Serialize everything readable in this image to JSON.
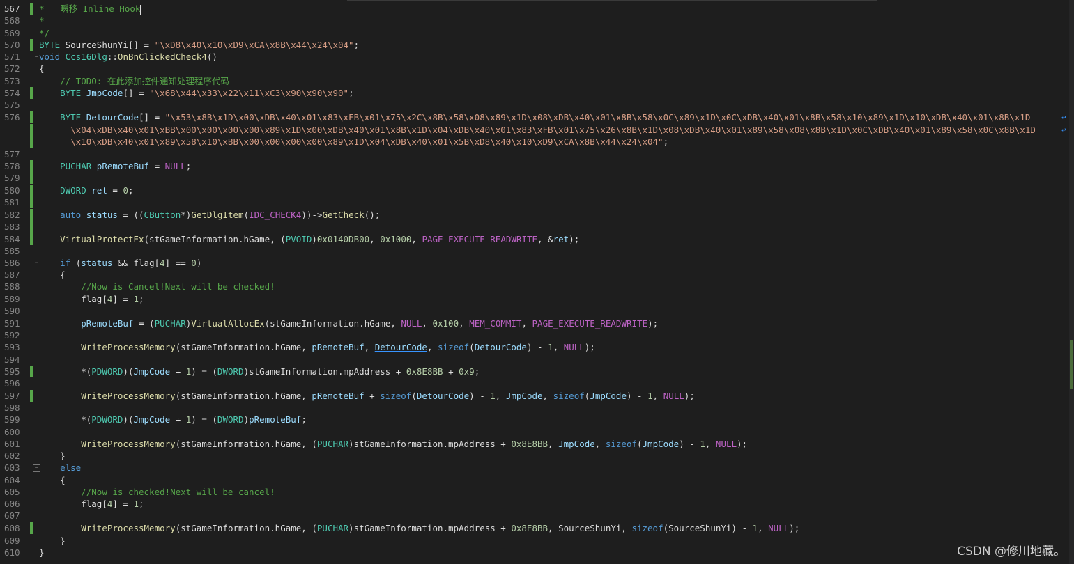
{
  "lines": [
    {
      "n": "567",
      "mark": true,
      "cursor": true,
      "tokens": [
        [
          "cmt",
          "*   瞬移 Inline Hook"
        ]
      ]
    },
    {
      "n": "568",
      "mark": false,
      "tokens": [
        [
          "cmt",
          "*"
        ]
      ]
    },
    {
      "n": "569",
      "mark": false,
      "tokens": [
        [
          "cmt",
          "*/"
        ]
      ]
    },
    {
      "n": "570",
      "mark": true,
      "tokens": [
        [
          "type",
          "BYTE"
        ],
        [
          "plain",
          " SourceShunYi[] = "
        ],
        [
          "str",
          "\"\\xD8\\x40\\x10\\xD9\\xCA\\x8B\\x44\\x24\\x04\""
        ],
        [
          "plain",
          ";"
        ]
      ]
    },
    {
      "n": "571",
      "mark": false,
      "fold": true,
      "tokens": [
        [
          "kw",
          "void"
        ],
        [
          "plain",
          " "
        ],
        [
          "type",
          "Ccs16Dlg"
        ],
        [
          "plain",
          "::"
        ],
        [
          "fn",
          "OnBnClickedCheck4"
        ],
        [
          "plain",
          "()"
        ]
      ]
    },
    {
      "n": "572",
      "mark": false,
      "tokens": [
        [
          "plain",
          "{"
        ]
      ]
    },
    {
      "n": "573",
      "mark": false,
      "tokens": [
        [
          "plain",
          "    "
        ],
        [
          "cmt",
          "// TODO: 在此添加控件通知处理程序代码"
        ]
      ]
    },
    {
      "n": "574",
      "mark": true,
      "tokens": [
        [
          "plain",
          "    "
        ],
        [
          "type",
          "BYTE"
        ],
        [
          "plain",
          " "
        ],
        [
          "var",
          "JmpCode"
        ],
        [
          "plain",
          "[] = "
        ],
        [
          "str",
          "\"\\x68\\x44\\x33\\x22\\x11\\xC3\\x90\\x90\\x90\""
        ],
        [
          "plain",
          ";"
        ]
      ]
    },
    {
      "n": "575",
      "mark": false,
      "tokens": []
    },
    {
      "n": "576",
      "mark": true,
      "wrap": true,
      "tokens": [
        [
          "plain",
          "    "
        ],
        [
          "type",
          "BYTE"
        ],
        [
          "plain",
          " "
        ],
        [
          "var",
          "DetourCode"
        ],
        [
          "plain",
          "[] = "
        ],
        [
          "str",
          "\"\\x53\\x8B\\x1D\\x00\\xDB\\x40\\x01\\x83\\xFB\\x01\\x75\\x2C\\x8B\\x58\\x08\\x89\\x1D\\x08\\xDB\\x40\\x01\\x8B\\x58\\x0C\\x89\\x1D\\x0C\\xDB\\x40\\x01\\x8B\\x58\\x10\\x89\\x1D\\x10\\xDB\\x40\\x01\\x8B\\x1D"
        ]
      ]
    },
    {
      "n": "",
      "mark": true,
      "wrap": true,
      "tokens": [
        [
          "str",
          "      \\x04\\xDB\\x40\\x01\\xBB\\x00\\x00\\x00\\x00\\x89\\x1D\\x00\\xDB\\x40\\x01\\x8B\\x1D\\x04\\xDB\\x40\\x01\\x83\\xFB\\x01\\x75\\x26\\x8B\\x1D\\x08\\xDB\\x40\\x01\\x89\\x58\\x08\\x8B\\x1D\\x0C\\xDB\\x40\\x01\\x89\\x58\\x0C\\x8B\\x1D"
        ]
      ]
    },
    {
      "n": "",
      "mark": true,
      "tokens": [
        [
          "str",
          "      \\x10\\xDB\\x40\\x01\\x89\\x58\\x10\\xBB\\x00\\x00\\x00\\x00\\x89\\x1D\\x04\\xDB\\x40\\x01\\x5B\\xD8\\x40\\x10\\xD9\\xCA\\x8B\\x44\\x24\\x04\""
        ],
        [
          "plain",
          ";"
        ]
      ]
    },
    {
      "n": "577",
      "mark": false,
      "tokens": []
    },
    {
      "n": "578",
      "mark": true,
      "tokens": [
        [
          "plain",
          "    "
        ],
        [
          "type",
          "PUCHAR"
        ],
        [
          "plain",
          " "
        ],
        [
          "var",
          "pRemoteBuf"
        ],
        [
          "plain",
          " = "
        ],
        [
          "mac",
          "NULL"
        ],
        [
          "plain",
          ";"
        ]
      ]
    },
    {
      "n": "579",
      "mark": true,
      "tokens": []
    },
    {
      "n": "580",
      "mark": true,
      "tokens": [
        [
          "plain",
          "    "
        ],
        [
          "type",
          "DWORD"
        ],
        [
          "plain",
          " "
        ],
        [
          "var",
          "ret"
        ],
        [
          "plain",
          " = "
        ],
        [
          "num",
          "0"
        ],
        [
          "plain",
          ";"
        ]
      ]
    },
    {
      "n": "581",
      "mark": true,
      "tokens": []
    },
    {
      "n": "582",
      "mark": true,
      "tokens": [
        [
          "plain",
          "    "
        ],
        [
          "kw",
          "auto"
        ],
        [
          "plain",
          " "
        ],
        [
          "var",
          "status"
        ],
        [
          "plain",
          " = (("
        ],
        [
          "type",
          "CButton"
        ],
        [
          "plain",
          "*)"
        ],
        [
          "fn",
          "GetDlgItem"
        ],
        [
          "plain",
          "("
        ],
        [
          "mac",
          "IDC_CHECK4"
        ],
        [
          "plain",
          "))->"
        ],
        [
          "fn",
          "GetCheck"
        ],
        [
          "plain",
          "();"
        ]
      ]
    },
    {
      "n": "583",
      "mark": true,
      "tokens": []
    },
    {
      "n": "584",
      "mark": true,
      "tokens": [
        [
          "plain",
          "    "
        ],
        [
          "fn",
          "VirtualProtectEx"
        ],
        [
          "plain",
          "(stGameInformation.hGame, ("
        ],
        [
          "type",
          "PVOID"
        ],
        [
          "plain",
          ")"
        ],
        [
          "num",
          "0x0140DB00"
        ],
        [
          "plain",
          ", "
        ],
        [
          "num",
          "0x1000"
        ],
        [
          "plain",
          ", "
        ],
        [
          "mac",
          "PAGE_EXECUTE_READWRITE"
        ],
        [
          "plain",
          ", &"
        ],
        [
          "var",
          "ret"
        ],
        [
          "plain",
          ");"
        ]
      ]
    },
    {
      "n": "585",
      "mark": false,
      "tokens": []
    },
    {
      "n": "586",
      "mark": false,
      "fold": true,
      "tokens": [
        [
          "plain",
          "    "
        ],
        [
          "kw",
          "if"
        ],
        [
          "plain",
          " ("
        ],
        [
          "var",
          "status"
        ],
        [
          "plain",
          " && flag["
        ],
        [
          "num",
          "4"
        ],
        [
          "plain",
          "] == "
        ],
        [
          "num",
          "0"
        ],
        [
          "plain",
          ")"
        ]
      ]
    },
    {
      "n": "587",
      "mark": false,
      "tokens": [
        [
          "plain",
          "    {"
        ]
      ]
    },
    {
      "n": "588",
      "mark": false,
      "tokens": [
        [
          "plain",
          "        "
        ],
        [
          "cmt",
          "//Now is Cancel!Next will be checked!"
        ]
      ]
    },
    {
      "n": "589",
      "mark": false,
      "tokens": [
        [
          "plain",
          "        flag["
        ],
        [
          "num",
          "4"
        ],
        [
          "plain",
          "] = "
        ],
        [
          "num",
          "1"
        ],
        [
          "plain",
          ";"
        ]
      ]
    },
    {
      "n": "590",
      "mark": false,
      "tokens": []
    },
    {
      "n": "591",
      "mark": false,
      "tokens": [
        [
          "plain",
          "        "
        ],
        [
          "var",
          "pRemoteBuf"
        ],
        [
          "plain",
          " = ("
        ],
        [
          "type",
          "PUCHAR"
        ],
        [
          "plain",
          ")"
        ],
        [
          "fn",
          "VirtualAllocEx"
        ],
        [
          "plain",
          "(stGameInformation.hGame, "
        ],
        [
          "mac",
          "NULL"
        ],
        [
          "plain",
          ", "
        ],
        [
          "num",
          "0x100"
        ],
        [
          "plain",
          ", "
        ],
        [
          "mac",
          "MEM_COMMIT"
        ],
        [
          "plain",
          ", "
        ],
        [
          "mac",
          "PAGE_EXECUTE_READWRITE"
        ],
        [
          "plain",
          ");"
        ]
      ]
    },
    {
      "n": "592",
      "mark": false,
      "tokens": []
    },
    {
      "n": "593",
      "mark": false,
      "tokens": [
        [
          "plain",
          "        "
        ],
        [
          "fn",
          "WriteProcessMemory"
        ],
        [
          "plain",
          "(stGameInformation.hGame, "
        ],
        [
          "var",
          "pRemoteBuf"
        ],
        [
          "plain",
          ", "
        ],
        [
          "und",
          "DetourCode"
        ],
        [
          "plain",
          ", "
        ],
        [
          "kw",
          "sizeof"
        ],
        [
          "plain",
          "("
        ],
        [
          "var",
          "DetourCode"
        ],
        [
          "plain",
          ") - "
        ],
        [
          "num",
          "1"
        ],
        [
          "plain",
          ", "
        ],
        [
          "mac",
          "NULL"
        ],
        [
          "plain",
          ");"
        ]
      ]
    },
    {
      "n": "594",
      "mark": false,
      "tokens": []
    },
    {
      "n": "595",
      "mark": true,
      "tokens": [
        [
          "plain",
          "        *("
        ],
        [
          "type",
          "PDWORD"
        ],
        [
          "plain",
          ")("
        ],
        [
          "var",
          "JmpCode"
        ],
        [
          "plain",
          " + "
        ],
        [
          "num",
          "1"
        ],
        [
          "plain",
          ") = ("
        ],
        [
          "type",
          "DWORD"
        ],
        [
          "plain",
          ")stGameInformation.mpAddress + "
        ],
        [
          "num",
          "0x8E8BB"
        ],
        [
          "plain",
          " + "
        ],
        [
          "num",
          "0x9"
        ],
        [
          "plain",
          ";"
        ]
      ]
    },
    {
      "n": "596",
      "mark": false,
      "tokens": []
    },
    {
      "n": "597",
      "mark": true,
      "tokens": [
        [
          "plain",
          "        "
        ],
        [
          "fn",
          "WriteProcessMemory"
        ],
        [
          "plain",
          "(stGameInformation.hGame, "
        ],
        [
          "var",
          "pRemoteBuf"
        ],
        [
          "plain",
          " + "
        ],
        [
          "kw",
          "sizeof"
        ],
        [
          "plain",
          "("
        ],
        [
          "var",
          "DetourCode"
        ],
        [
          "plain",
          ") - "
        ],
        [
          "num",
          "1"
        ],
        [
          "plain",
          ", "
        ],
        [
          "var",
          "JmpCode"
        ],
        [
          "plain",
          ", "
        ],
        [
          "kw",
          "sizeof"
        ],
        [
          "plain",
          "("
        ],
        [
          "var",
          "JmpCode"
        ],
        [
          "plain",
          ") - "
        ],
        [
          "num",
          "1"
        ],
        [
          "plain",
          ", "
        ],
        [
          "mac",
          "NULL"
        ],
        [
          "plain",
          ");"
        ]
      ]
    },
    {
      "n": "598",
      "mark": false,
      "tokens": []
    },
    {
      "n": "599",
      "mark": false,
      "tokens": [
        [
          "plain",
          "        *("
        ],
        [
          "type",
          "PDWORD"
        ],
        [
          "plain",
          ")("
        ],
        [
          "var",
          "JmpCode"
        ],
        [
          "plain",
          " + "
        ],
        [
          "num",
          "1"
        ],
        [
          "plain",
          ") = ("
        ],
        [
          "type",
          "DWORD"
        ],
        [
          "plain",
          ")"
        ],
        [
          "var",
          "pRemoteBuf"
        ],
        [
          "plain",
          ";"
        ]
      ]
    },
    {
      "n": "600",
      "mark": false,
      "tokens": []
    },
    {
      "n": "601",
      "mark": false,
      "tokens": [
        [
          "plain",
          "        "
        ],
        [
          "fn",
          "WriteProcessMemory"
        ],
        [
          "plain",
          "(stGameInformation.hGame, ("
        ],
        [
          "type",
          "PUCHAR"
        ],
        [
          "plain",
          ")stGameInformation.mpAddress + "
        ],
        [
          "num",
          "0x8E8BB"
        ],
        [
          "plain",
          ", "
        ],
        [
          "var",
          "JmpCode"
        ],
        [
          "plain",
          ", "
        ],
        [
          "kw",
          "sizeof"
        ],
        [
          "plain",
          "("
        ],
        [
          "var",
          "JmpCode"
        ],
        [
          "plain",
          ") - "
        ],
        [
          "num",
          "1"
        ],
        [
          "plain",
          ", "
        ],
        [
          "mac",
          "NULL"
        ],
        [
          "plain",
          ");"
        ]
      ]
    },
    {
      "n": "602",
      "mark": false,
      "tokens": [
        [
          "plain",
          "    }"
        ]
      ]
    },
    {
      "n": "603",
      "mark": false,
      "fold": true,
      "tokens": [
        [
          "plain",
          "    "
        ],
        [
          "kw",
          "else"
        ]
      ]
    },
    {
      "n": "604",
      "mark": false,
      "tokens": [
        [
          "plain",
          "    {"
        ]
      ]
    },
    {
      "n": "605",
      "mark": false,
      "tokens": [
        [
          "plain",
          "        "
        ],
        [
          "cmt",
          "//Now is checked!Next will be cancel!"
        ]
      ]
    },
    {
      "n": "606",
      "mark": false,
      "tokens": [
        [
          "plain",
          "        flag["
        ],
        [
          "num",
          "4"
        ],
        [
          "plain",
          "] = "
        ],
        [
          "num",
          "1"
        ],
        [
          "plain",
          ";"
        ]
      ]
    },
    {
      "n": "607",
      "mark": false,
      "tokens": []
    },
    {
      "n": "608",
      "mark": true,
      "tokens": [
        [
          "plain",
          "        "
        ],
        [
          "fn",
          "WriteProcessMemory"
        ],
        [
          "plain",
          "(stGameInformation.hGame, ("
        ],
        [
          "type",
          "PUCHAR"
        ],
        [
          "plain",
          ")stGameInformation.mpAddress + "
        ],
        [
          "num",
          "0x8E8BB"
        ],
        [
          "plain",
          ", SourceShunYi, "
        ],
        [
          "kw",
          "sizeof"
        ],
        [
          "plain",
          "(SourceShunYi) - "
        ],
        [
          "num",
          "1"
        ],
        [
          "plain",
          ", "
        ],
        [
          "mac",
          "NULL"
        ],
        [
          "plain",
          ");"
        ]
      ]
    },
    {
      "n": "609",
      "mark": false,
      "tokens": [
        [
          "plain",
          "    }"
        ]
      ]
    },
    {
      "n": "610",
      "mark": false,
      "tokens": [
        [
          "plain",
          "}"
        ]
      ]
    }
  ],
  "watermark": "CSDN @修川地藏。",
  "colors": {
    "background": "#1e1e1e",
    "changeMarker": "#57a64a"
  }
}
